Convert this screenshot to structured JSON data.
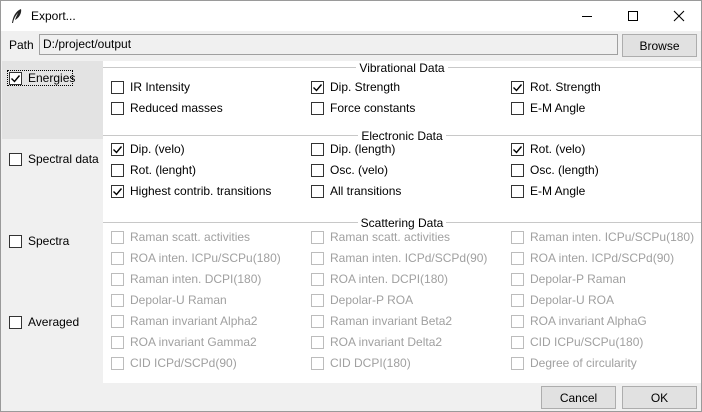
{
  "window": {
    "title": "Export..."
  },
  "path": {
    "label": "Path",
    "value": "D:/project/output",
    "browse_label": "Browse"
  },
  "left": [
    {
      "label": "Energies",
      "checked": true
    },
    {
      "label": "Spectral data",
      "checked": false
    },
    {
      "label": "Spectra",
      "checked": false
    },
    {
      "label": "Averaged",
      "checked": false
    }
  ],
  "vibrational": {
    "title": "Vibrational Data",
    "items": [
      {
        "label": "IR Intensity",
        "checked": false
      },
      {
        "label": "Dip. Strength",
        "checked": true
      },
      {
        "label": "Rot. Strength",
        "checked": true
      },
      {
        "label": "Reduced masses",
        "checked": false
      },
      {
        "label": "Force constants",
        "checked": false
      },
      {
        "label": "E-M Angle",
        "checked": false
      }
    ]
  },
  "electronic": {
    "title": "Electronic Data",
    "items": [
      {
        "label": "Dip. (velo)",
        "checked": true
      },
      {
        "label": "Dip. (length)",
        "checked": false
      },
      {
        "label": "Rot. (velo)",
        "checked": true
      },
      {
        "label": "Rot. (lenght)",
        "checked": false
      },
      {
        "label": "Osc. (velo)",
        "checked": false
      },
      {
        "label": "Osc. (length)",
        "checked": false
      },
      {
        "label": "Highest contrib. transitions",
        "checked": true
      },
      {
        "label": "All transitions",
        "checked": false
      },
      {
        "label": "E-M Angle",
        "checked": false
      }
    ]
  },
  "scattering": {
    "title": "Scattering Data",
    "items": [
      {
        "label": "Raman scatt. activities"
      },
      {
        "label": "Raman scatt. activities"
      },
      {
        "label": "Raman inten. ICPu/SCPu(180)"
      },
      {
        "label": "ROA inten. ICPu/SCPu(180)"
      },
      {
        "label": "Raman inten. ICPd/SCPd(90)"
      },
      {
        "label": "ROA inten. ICPd/SCPd(90)"
      },
      {
        "label": "Raman inten. DCPI(180)"
      },
      {
        "label": "ROA inten. DCPI(180)"
      },
      {
        "label": "Depolar-P Raman"
      },
      {
        "label": "Depolar-U Raman"
      },
      {
        "label": "Depolar-P ROA"
      },
      {
        "label": "Depolar-U ROA"
      },
      {
        "label": "Raman invariant Alpha2"
      },
      {
        "label": "Raman invariant Beta2"
      },
      {
        "label": "ROA invariant AlphaG"
      },
      {
        "label": "ROA invariant Gamma2"
      },
      {
        "label": "ROA invariant Delta2"
      },
      {
        "label": "CID ICPu/SCPu(180)"
      },
      {
        "label": "CID ICPd/SCPd(90)"
      },
      {
        "label": "CID DCPI(180)"
      },
      {
        "label": "Degree of circularity"
      }
    ]
  },
  "buttons": {
    "cancel": "Cancel",
    "ok": "OK"
  }
}
